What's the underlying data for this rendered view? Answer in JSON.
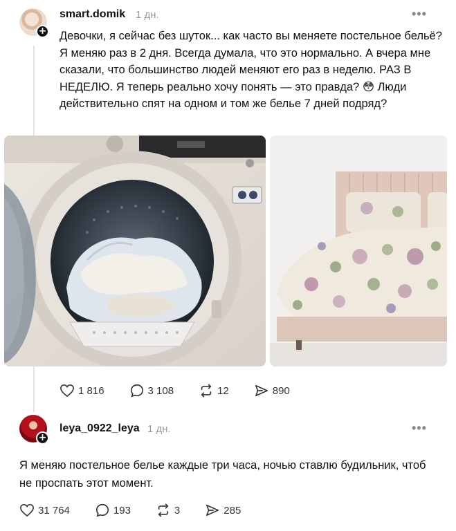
{
  "post": {
    "username": "smart.domik",
    "time": "1 дн.",
    "more": "•••",
    "text": "Девочки, я сейчас без шуток... как часто вы меняете постельное бельё? Я меняю раз в 2 дня. Всегда думала, что это нормально. А вчера мне сказали, что большинство людей меняют его раз в неделю. РАЗ В НЕДЕЛЮ. Я теперь реально хочу понять — это правда? 😳 Люди действительно спят на одном и том же белье 7 дней подряд?",
    "likes": "1 816",
    "replies": "3 108",
    "reposts": "12",
    "shares": "890"
  },
  "reply": {
    "username": "leya_0922_leya",
    "time": "1 дн.",
    "more": "•••",
    "text": "Я меняю постельное белье каждые три часа, ночью ставлю будильник, чтоб не проспать этот момент.",
    "likes": "31 764",
    "replies": "193",
    "reposts": "3",
    "shares": "285"
  },
  "icons": {
    "like": "heart-icon",
    "reply": "speech-bubble-icon",
    "repost": "repost-arrows-icon",
    "share": "send-icon",
    "add": "plus-icon"
  },
  "colors": {
    "background": "#ffffff",
    "text": "#111111",
    "muted": "#9a9a9a",
    "thread_line": "#e3e3e3"
  }
}
